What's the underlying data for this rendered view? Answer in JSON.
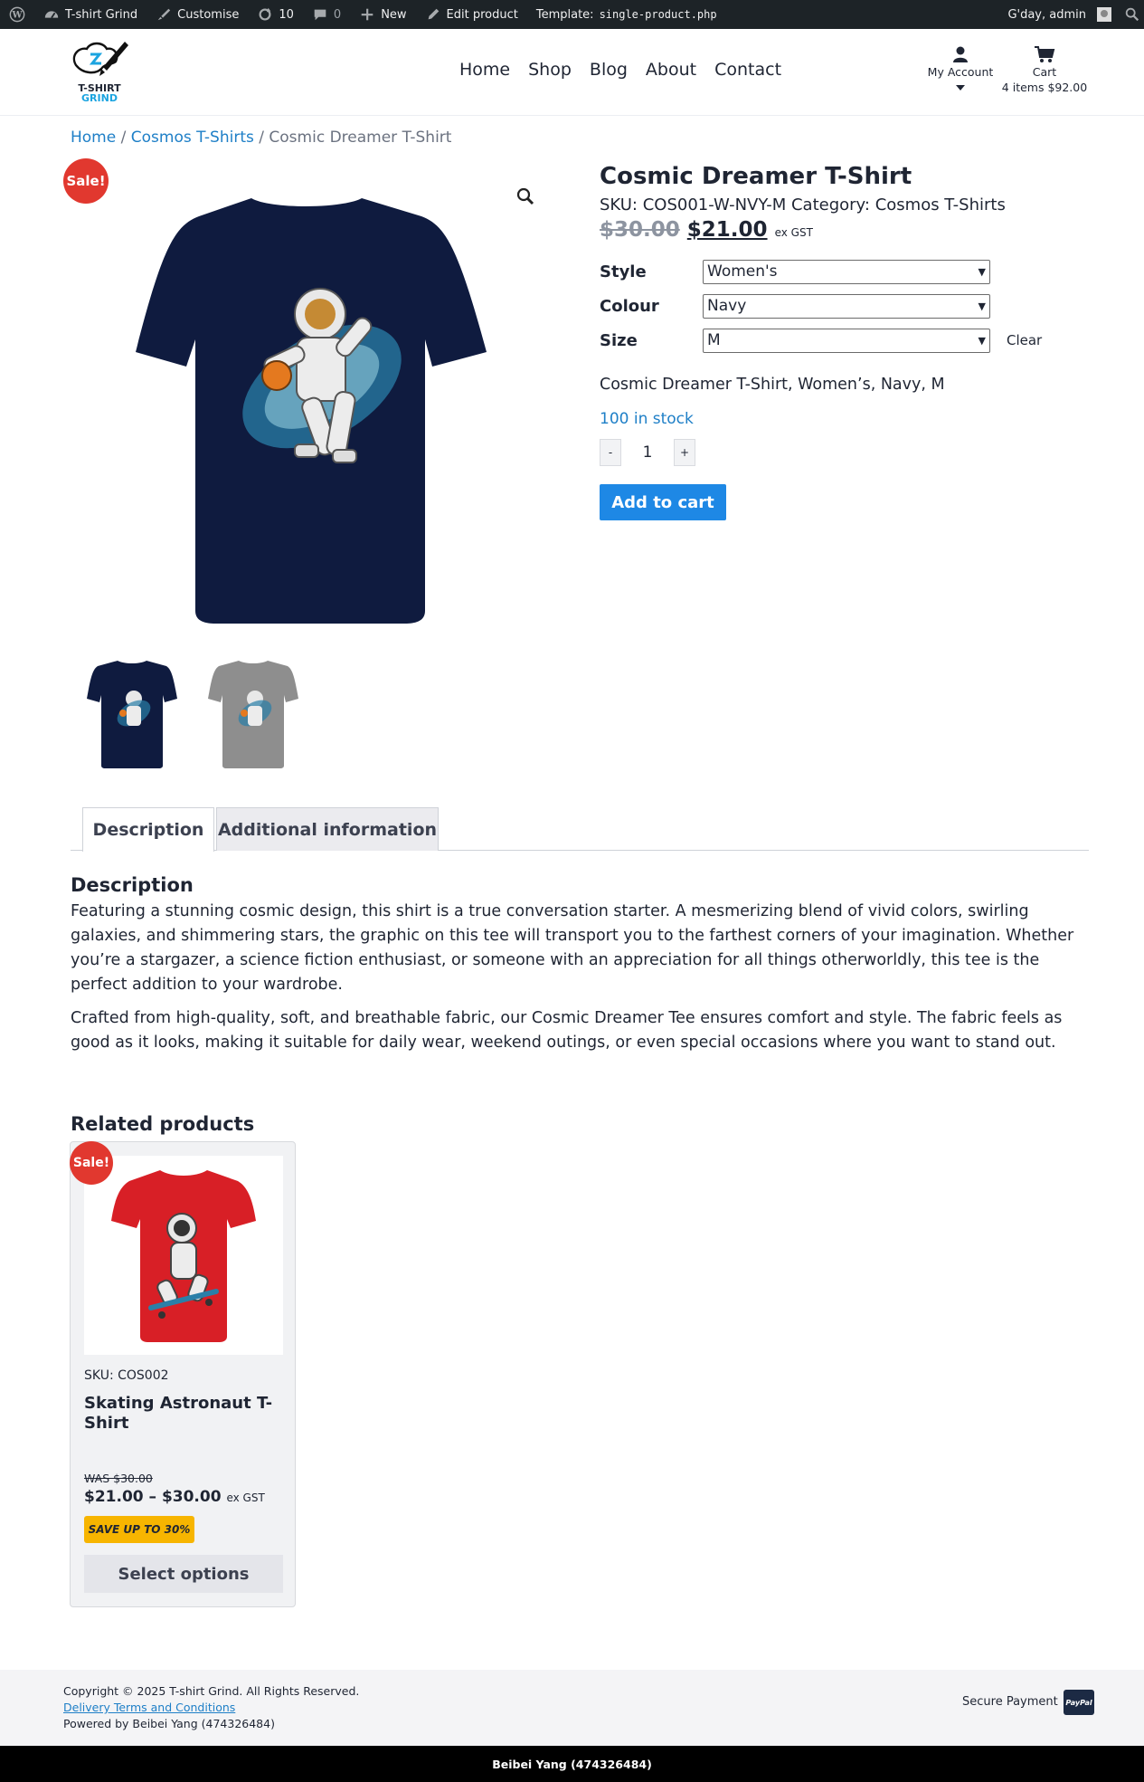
{
  "admin_bar": {
    "site_name": "T-shirt Grind",
    "customise": "Customise",
    "updates_count": "10",
    "comments_count": "0",
    "new_label": "New",
    "edit_product": "Edit product",
    "template_label": "Template:",
    "template_file": "single-product.php",
    "greeting": "G'day, admin"
  },
  "header": {
    "logo_line1": "T-SHIRT",
    "logo_line2": "GRIND",
    "nav": [
      "Home",
      "Shop",
      "Blog",
      "About",
      "Contact"
    ],
    "account_label": "My Account",
    "cart_label": "Cart",
    "cart_summary": "4 items $92.00"
  },
  "breadcrumb": {
    "home": "Home",
    "category": "Cosmos T-Shirts",
    "current": "Cosmic Dreamer T-Shirt",
    "separator": " / "
  },
  "product": {
    "sale_badge": "Sale!",
    "title": "Cosmic Dreamer T-Shirt",
    "sku_label": "SKU:",
    "sku": "COS001-W-NVY-M",
    "category_label": "Category:",
    "category": "Cosmos T-Shirts",
    "old_price": "$30.00",
    "new_price": "$21.00",
    "tax_note": "ex GST",
    "variations": [
      {
        "label": "Style",
        "value": "Women's"
      },
      {
        "label": "Colour",
        "value": "Navy"
      },
      {
        "label": "Size",
        "value": "M"
      }
    ],
    "clear": "Clear",
    "variation_description": "Cosmic Dreamer T-Shirt, Women’s, Navy, M",
    "stock": "100 in stock",
    "qty_minus": "-",
    "qty_value": "1",
    "qty_plus": "+",
    "add_to_cart": "Add to cart",
    "main_shirt_color": "#0f1b3f",
    "thumbnails": [
      {
        "color": "#0f1b3f"
      },
      {
        "color": "#8e8e8e"
      }
    ]
  },
  "tabs": [
    {
      "label": "Description",
      "active": true
    },
    {
      "label": "Additional information",
      "active": false
    }
  ],
  "description": {
    "heading": "Description",
    "paragraphs": [
      "Featuring a stunning cosmic design, this shirt is a true conversation starter. A mesmerizing blend of vivid colors, swirling galaxies, and shimmering stars, the graphic on this tee will transport you to the farthest corners of your imagination. Whether you’re a stargazer, a science fiction enthusiast, or someone with an appreciation for all things otherworldly, this tee is the perfect addition to your wardrobe.",
      "Crafted from high-quality, soft, and breathable fabric, our Cosmic Dreamer Tee ensures comfort and style. The fabric feels as good as it looks, making it suitable for daily wear, weekend outings, or even special occasions where you want to stand out."
    ]
  },
  "related": {
    "heading": "Related products",
    "items": [
      {
        "sale_badge": "Sale!",
        "sku": "SKU: COS002",
        "name": "Skating Astronaut T-Shirt",
        "was": "WAS $30.00",
        "price_range": "$21.00 – $30.00",
        "tax_note": "ex GST",
        "save_badge": "SAVE UP TO 30%",
        "button": "Select options",
        "shirt_color": "#d81f26"
      }
    ]
  },
  "footer": {
    "copyright": "Copyright © 2025 T-shirt Grind. All Rights Reserved.",
    "delivery_link": "Delivery Terms and Conditions",
    "powered_by": "Powered by Beibei Yang (474326484)",
    "secure_payment": "Secure Payment",
    "paypal": "PayPal",
    "bottom_bar": "Beibei Yang (474326484)"
  }
}
